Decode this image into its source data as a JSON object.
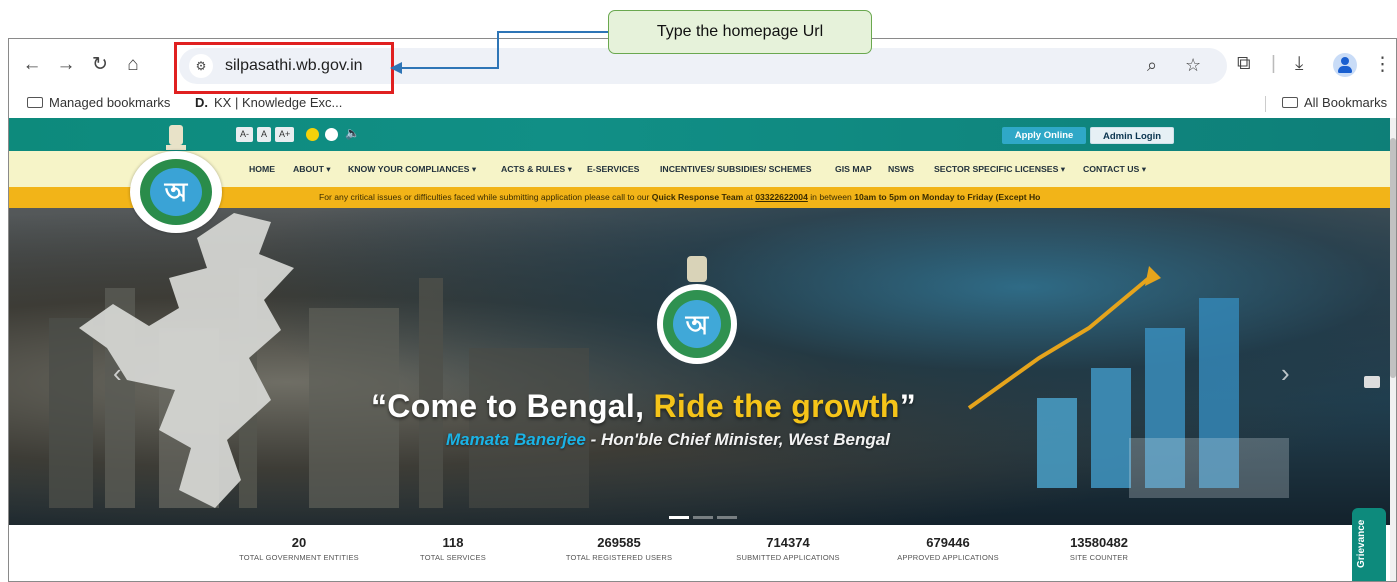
{
  "heading": "",
  "annotation": {
    "callout_text": "Type the homepage Url"
  },
  "browser": {
    "url": "silpasathi.wb.gov.in",
    "bookmarks": [
      {
        "label": "Managed bookmarks",
        "icon": "folder-managed-icon"
      },
      {
        "prefix": "D.",
        "label": "KX | Knowledge Exc..."
      }
    ],
    "all_bookmarks_label": "All Bookmarks"
  },
  "site": {
    "a11y": {
      "decrease": "A-",
      "normal": "A",
      "increase": "A+"
    },
    "apply_label": "Apply Online",
    "admin_label": "Admin Login",
    "menu": [
      "HOME",
      "ABOUT ▾",
      "KNOW YOUR COMPLIANCES ▾",
      "ACTS & RULES ▾",
      "E-SERVICES",
      "INCENTIVES/ SUBSIDIES/ SCHEMES",
      "GIS MAP",
      "NSWS",
      "SECTOR SPECIFIC LICENSES ▾",
      "CONTACT US ▾"
    ],
    "notice": {
      "pre": "For any critical issues or difficulties faced while submitting application please call to our ",
      "team": "Quick Response Team",
      "at": " at ",
      "phone": "03322622004",
      "between": " in between ",
      "hours": "10am to 5pm on Monday to Friday (Except Ho"
    },
    "hero": {
      "quote_pre": "“Come to Bengal, ",
      "quote_hl": "Ride the growth",
      "quote_post": "”",
      "sub_name": "Mamata Banerjee",
      "sub_rest": " - Hon'ble Chief Minister, West Bengal",
      "slides": 3,
      "active_slide": 0
    },
    "stats": [
      {
        "value": "20",
        "label": "TOTAL GOVERNMENT ENTITIES"
      },
      {
        "value": "118",
        "label": "TOTAL SERVICES"
      },
      {
        "value": "269585",
        "label": "TOTAL REGISTERED USERS"
      },
      {
        "value": "714374",
        "label": "SUBMITTED APPLICATIONS"
      },
      {
        "value": "679446",
        "label": "APPROVED APPLICATIONS"
      },
      {
        "value": "13580482",
        "label": "SITE COUNTER"
      }
    ],
    "grievance_label": "Grievance"
  },
  "colors": {
    "teal": "#0d8a7c",
    "notice": "#f2b418",
    "highlight": "#e02020",
    "callout_border": "#6aa84f"
  }
}
